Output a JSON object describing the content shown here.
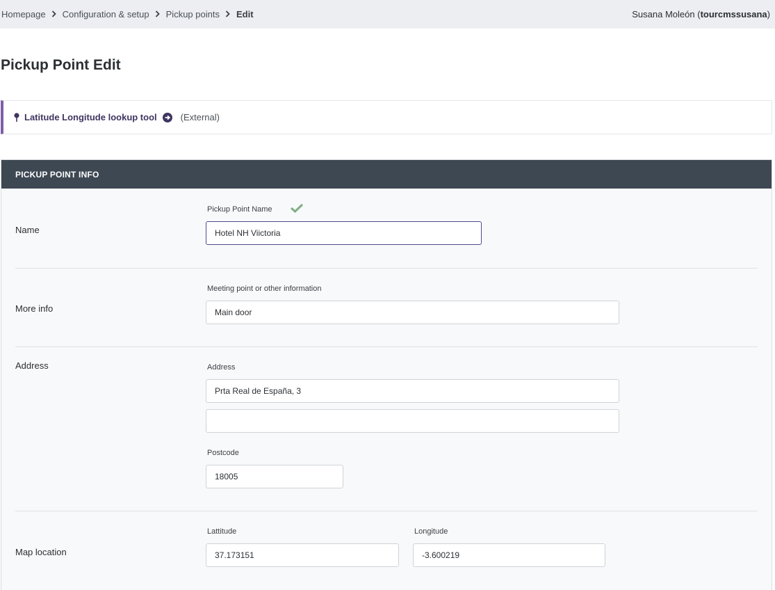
{
  "breadcrumb": {
    "items": [
      "Homepage",
      "Configuration & setup",
      "Pickup points"
    ],
    "current": "Edit"
  },
  "user": {
    "display_name": "Susana Moleón",
    "username": "tourcmssusana",
    "open_paren": "(",
    "close_paren": ")"
  },
  "page": {
    "title": "Pickup Point Edit"
  },
  "lookup_tool": {
    "label": "Latitude Longitude lookup tool",
    "note": "(External)",
    "accent_color": "#7b5ea7",
    "icons": [
      "map-pin-icon",
      "arrow-circle-right-icon"
    ]
  },
  "panel": {
    "header": "PICKUP POINT INFO",
    "header_color": "#3d4853",
    "rows": {
      "name": {
        "label": "Name",
        "field_label": "Pickup Point Name",
        "value": "Hotel NH Viictoria",
        "valid": true,
        "valid_icon": "checkmark-icon",
        "valid_color": "#7fae84"
      },
      "more_info": {
        "label": "More info",
        "field_label": "Meeting point or other information",
        "value": "Main door"
      },
      "address": {
        "label": "Address",
        "field_label": "Address",
        "line1": "Prta Real de España, 3",
        "line2": "",
        "postcode_label": "Postcode",
        "postcode": "18005"
      },
      "map_location": {
        "label": "Map location",
        "latitude_label": "Lattitude",
        "latitude": "37.173151",
        "longitude_label": "Longitude",
        "longitude": "-3.600219"
      }
    }
  }
}
